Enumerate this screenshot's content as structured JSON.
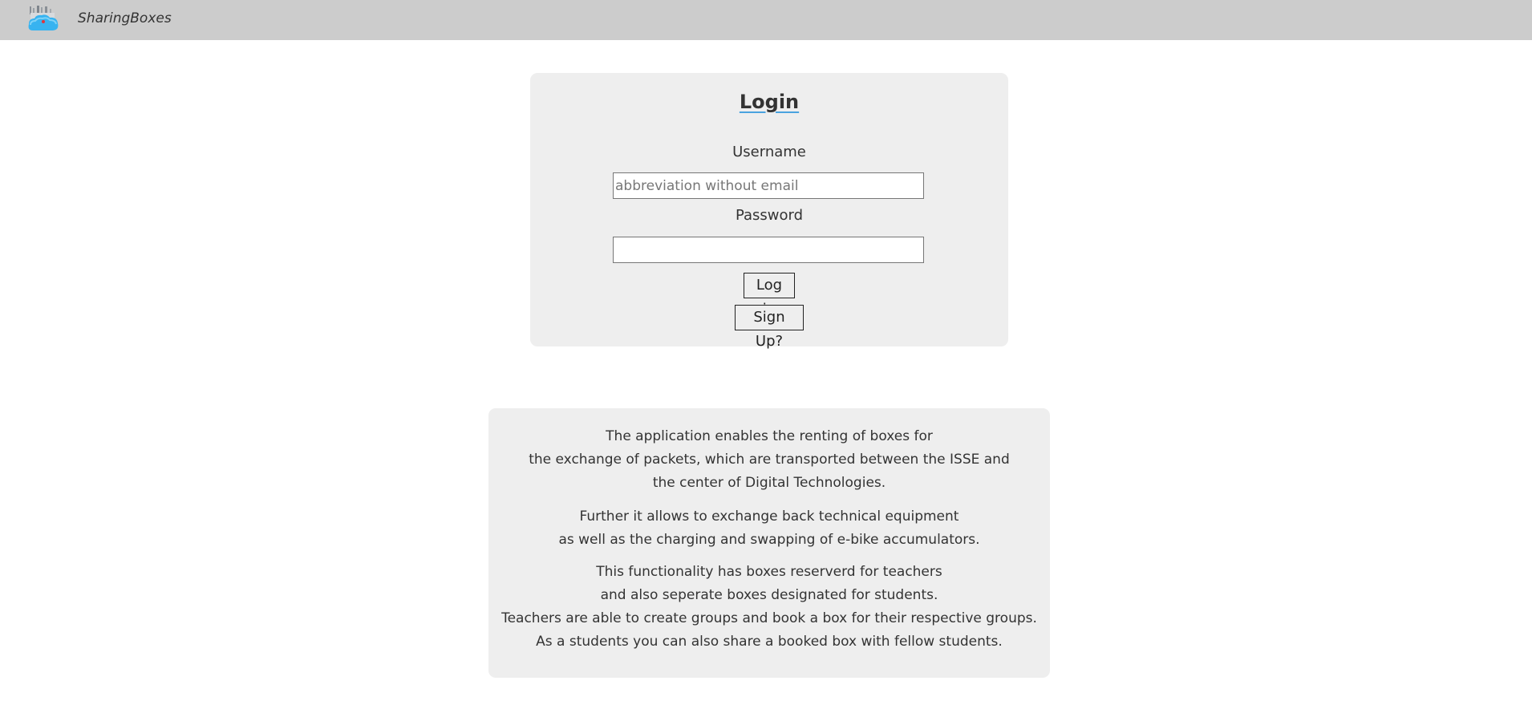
{
  "header": {
    "brand": "SharingBoxes",
    "logo_icon": "cloud-box-logo-icon"
  },
  "login": {
    "title": "Login",
    "username_label": "Username",
    "username_placeholder": "abbreviation without email",
    "username_value": "",
    "password_label": "Password",
    "password_value": "",
    "login_button": "Log in",
    "signup_button": "Sign Up?"
  },
  "info": {
    "para1": [
      "The application enables the renting of boxes for",
      "the exchange of packets, which are transported between the ISSE and",
      "the center of Digital Technologies."
    ],
    "para2": [
      "Further it allows to exchange back technical equipment",
      "as well as the charging and swapping of e-bike accumulators."
    ],
    "para3": [
      "This functionality has boxes reserverd for teachers",
      "and also seperate boxes designated for students.",
      "Teachers are able to create groups and book a box for their respective groups.",
      "As a students you can also share a booked box with fellow students."
    ]
  },
  "colors": {
    "topbar": "#cccccc",
    "card": "#eeeeee",
    "accent": "#4aa3df"
  }
}
